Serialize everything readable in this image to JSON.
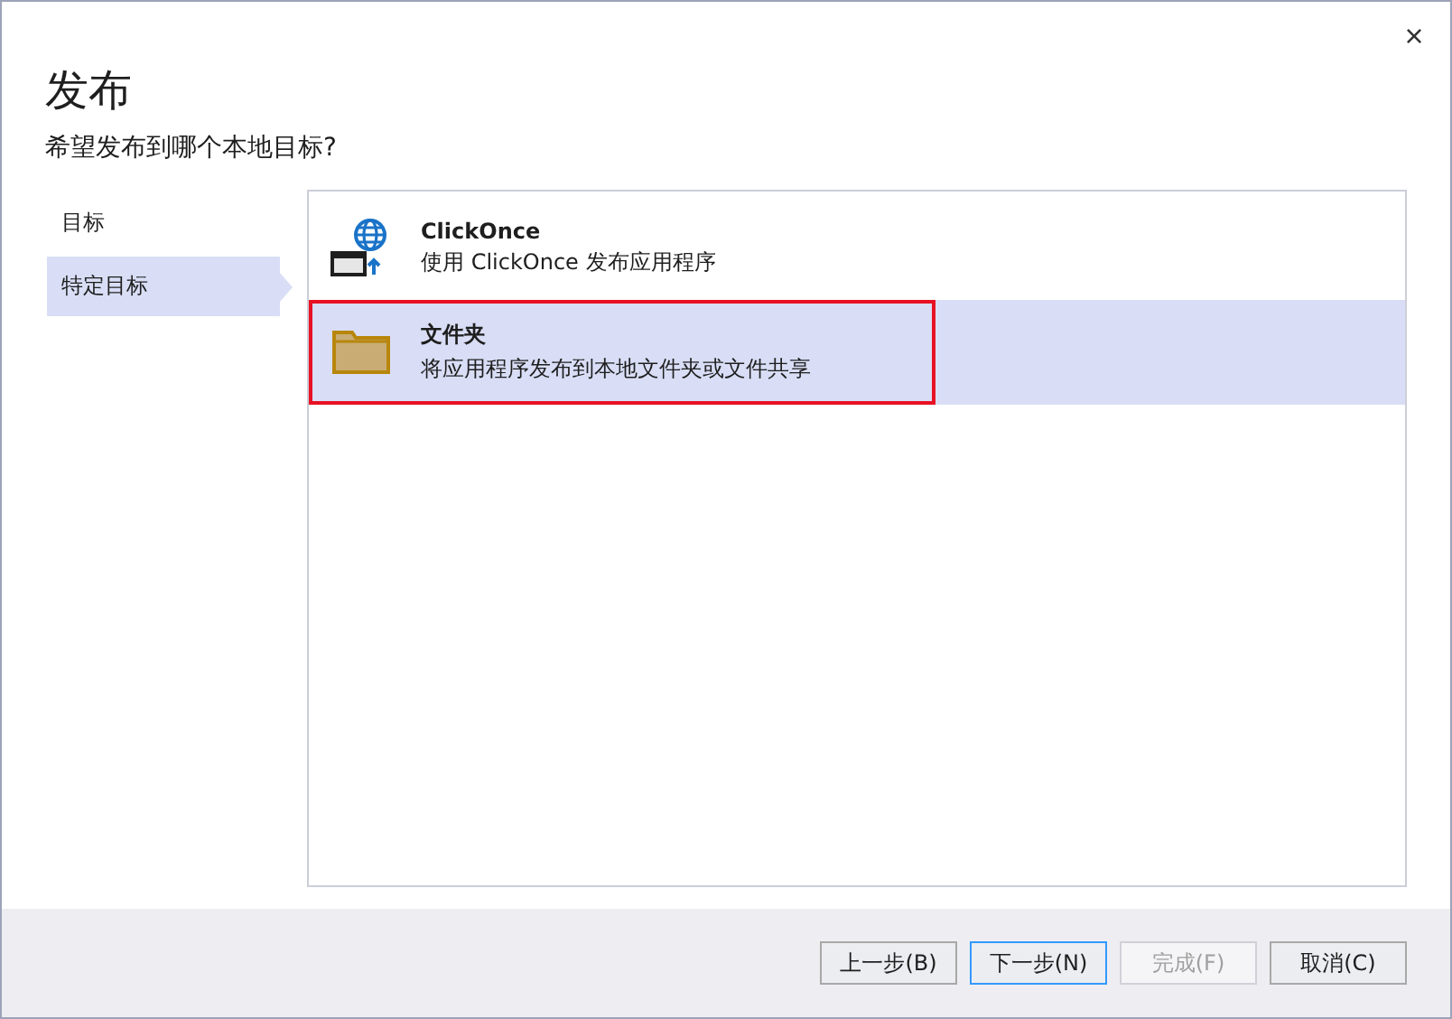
{
  "window": {
    "close": "×",
    "title": "发布",
    "subtitle": "希望发布到哪个本地目标?"
  },
  "nav": [
    {
      "label": "目标",
      "selected": false
    },
    {
      "label": "特定目标",
      "selected": true
    }
  ],
  "targets": [
    {
      "kind": "clickonce",
      "title": "ClickOnce",
      "description": "使用 ClickOnce 发布应用程序",
      "selected": false,
      "outlined": false
    },
    {
      "kind": "folder",
      "title": "文件夹",
      "description": "将应用程序发布到本地文件夹或文件共享",
      "selected": true,
      "outlined": true
    }
  ],
  "buttons": [
    {
      "label": "上一步(B)",
      "disabled": false,
      "focused": false
    },
    {
      "label": "下一步(N)",
      "disabled": false,
      "focused": true
    },
    {
      "label": "完成(F)",
      "disabled": true,
      "focused": false
    },
    {
      "label": "取消(C)",
      "disabled": false,
      "focused": false
    }
  ]
}
